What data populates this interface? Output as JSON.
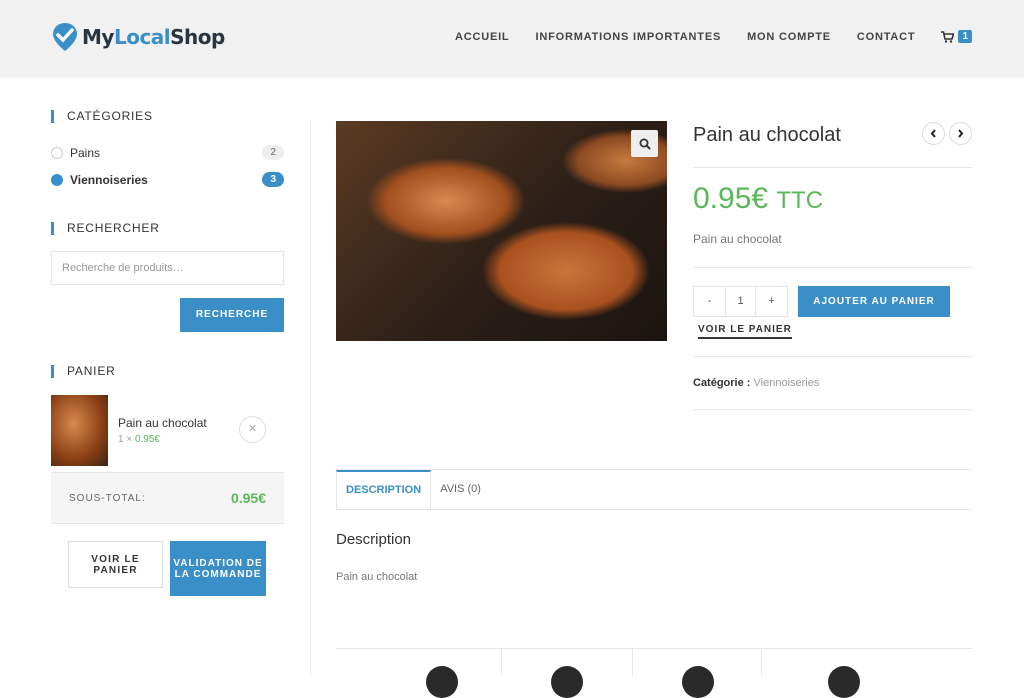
{
  "brand": {
    "part1": "My",
    "part2": "Local",
    "part3": "Shop"
  },
  "nav": {
    "items": [
      "ACCUEIL",
      "INFORMATIONS IMPORTANTES",
      "MON COMPTE",
      "CONTACT"
    ],
    "cart_count": "1"
  },
  "sidebar": {
    "categories_title": "CATÉGORIES",
    "categories": [
      {
        "name": "Pains",
        "count": "2"
      },
      {
        "name": "Viennoiseries",
        "count": "3"
      }
    ],
    "search_title": "RECHERCHER",
    "search_placeholder": "Recherche de produits…",
    "search_button": "RECHERCHE",
    "cart_title": "PANIER",
    "cart_item": {
      "name": "Pain au chocolat",
      "qty": "1 ×",
      "price": "0.95€"
    },
    "subtotal_label": "SOUS-TOTAL:",
    "subtotal_value": "0.95€",
    "view_cart": "VOIR LE PANIER",
    "checkout": "VALIDATION DE LA COMMANDE"
  },
  "product": {
    "title": "Pain au chocolat",
    "price": "0.95€",
    "price_suffix": "TTC",
    "short_desc": "Pain au chocolat",
    "qty_minus": "-",
    "qty": "1",
    "qty_plus": "+",
    "add_to_cart": "AJOUTER AU PANIER",
    "view_cart": "VOIR LE PANIER",
    "category_label": "Catégorie :",
    "category": "Viennoiseries"
  },
  "tabs": [
    "DESCRIPTION",
    "AVIS (0)"
  ],
  "description": {
    "heading": "Description",
    "text": "Pain au chocolat"
  },
  "colors": {
    "accent": "#3b8fc8",
    "price": "#5bb75b"
  }
}
